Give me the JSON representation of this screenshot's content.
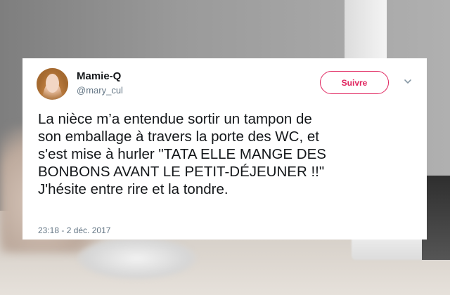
{
  "tweet": {
    "display_name": "Mamie-Q",
    "handle": "@mary_cul",
    "follow_label": "Suivre",
    "text": "La nièce m’a entendue sortir un tampon de\nson emballage à travers la porte des WC, et\ns'est mise à hurler \"TATA ELLE MANGE DES\nBONBONS AVANT LE PETIT-DÉJEUNER !!\"\nJ'hésite entre rire et la tondre.",
    "timestamp": "23:18 - 2 déc. 2017"
  },
  "icons": {
    "avatar": "profile-photo",
    "menu": "chevron-down-icon"
  },
  "colors": {
    "follow_accent": "#e0245e",
    "text": "#14171a",
    "muted": "#657786"
  }
}
